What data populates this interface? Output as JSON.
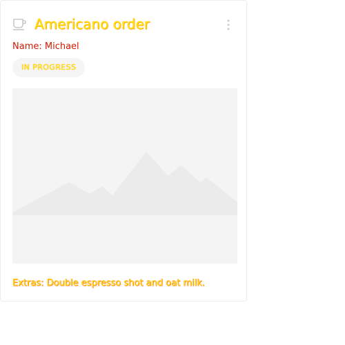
{
  "card": {
    "title": "Americano order",
    "name_line": "Name: Michael",
    "status_badge": "IN PROGRESS",
    "extras_line": "Extras: Double espresso shot and oat milk.",
    "icons": {
      "leading": "coffee-cup-icon",
      "menu": "more-vert-icon",
      "image": "image-placeholder-icon"
    }
  },
  "colors": {
    "title_text": "#ffe600",
    "name_text": "#d11a00",
    "badge_bg": "#f5f5f5",
    "placeholder_bg": "#f4f4f4",
    "mountain": "#eaeaea"
  }
}
